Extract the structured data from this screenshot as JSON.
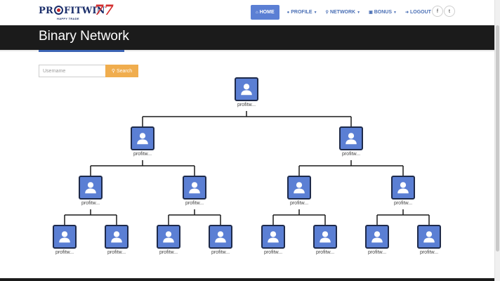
{
  "brand": {
    "logo_text_before": "PR",
    "logo_text_after": "FITWIN",
    "logo_number": "77",
    "logo_tagline": "HAPPY TRADE"
  },
  "nav": {
    "items": [
      {
        "label": "HOME",
        "icon": "home-icon",
        "active": true
      },
      {
        "label": "PROFILE",
        "icon": "user-icon",
        "dropdown": true
      },
      {
        "label": "NETWORK",
        "icon": "sitemap-icon",
        "dropdown": true
      },
      {
        "label": "BONUS",
        "icon": "money-icon",
        "dropdown": true
      },
      {
        "label": "LOGOUT",
        "icon": "sign-out-icon"
      }
    ],
    "social": [
      {
        "label": "f",
        "icon": "facebook-icon"
      },
      {
        "label": "t",
        "icon": "twitter-icon"
      }
    ]
  },
  "page": {
    "title": "Binary Network"
  },
  "search": {
    "placeholder": "Username",
    "value": "",
    "button_label": "Search"
  },
  "tree": {
    "node_color": "#5b7fd4",
    "nodes": [
      {
        "id": "root",
        "label": "profitw...",
        "level": 0
      },
      {
        "id": "L",
        "label": "profitw...",
        "level": 1
      },
      {
        "id": "R",
        "label": "profitw...",
        "level": 1
      },
      {
        "id": "LL",
        "label": "profitw...",
        "level": 2
      },
      {
        "id": "LR",
        "label": "profitw...",
        "level": 2
      },
      {
        "id": "RL",
        "label": "profitw...",
        "level": 2
      },
      {
        "id": "RR",
        "label": "profitw...",
        "level": 2
      },
      {
        "id": "LLL",
        "label": "profitw...",
        "level": 3
      },
      {
        "id": "LLR",
        "label": "profitw...",
        "level": 3
      },
      {
        "id": "LRL",
        "label": "profitw...",
        "level": 3
      },
      {
        "id": "LRR",
        "label": "profitw...",
        "level": 3
      },
      {
        "id": "RLL",
        "label": "profitw...",
        "level": 3
      },
      {
        "id": "RLR",
        "label": "profitw...",
        "level": 3
      },
      {
        "id": "RRL",
        "label": "profitw...",
        "level": 3
      },
      {
        "id": "RRR",
        "label": "profitw...",
        "level": 3
      }
    ]
  }
}
